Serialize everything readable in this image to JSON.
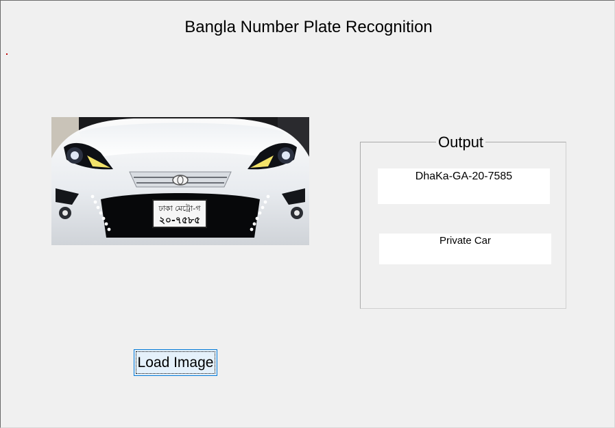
{
  "window": {
    "title": "Bangla Number Plate Recognition"
  },
  "image_panel": {
    "icon": "car-front-photo",
    "plate_line1": "ঢাকা মেট্রো-গ",
    "plate_line2": "২০-৭৫৮৫"
  },
  "output": {
    "legend": "Output",
    "plate_text": "DhaKa-GA-20-7585",
    "vehicle_type": "Private Car"
  },
  "actions": {
    "load_image_label": "Load Image"
  },
  "colors": {
    "background": "#f0f0f0",
    "button_fill": "#e5f1fb",
    "button_border": "#0078d7",
    "text_box": "#ffffff"
  }
}
